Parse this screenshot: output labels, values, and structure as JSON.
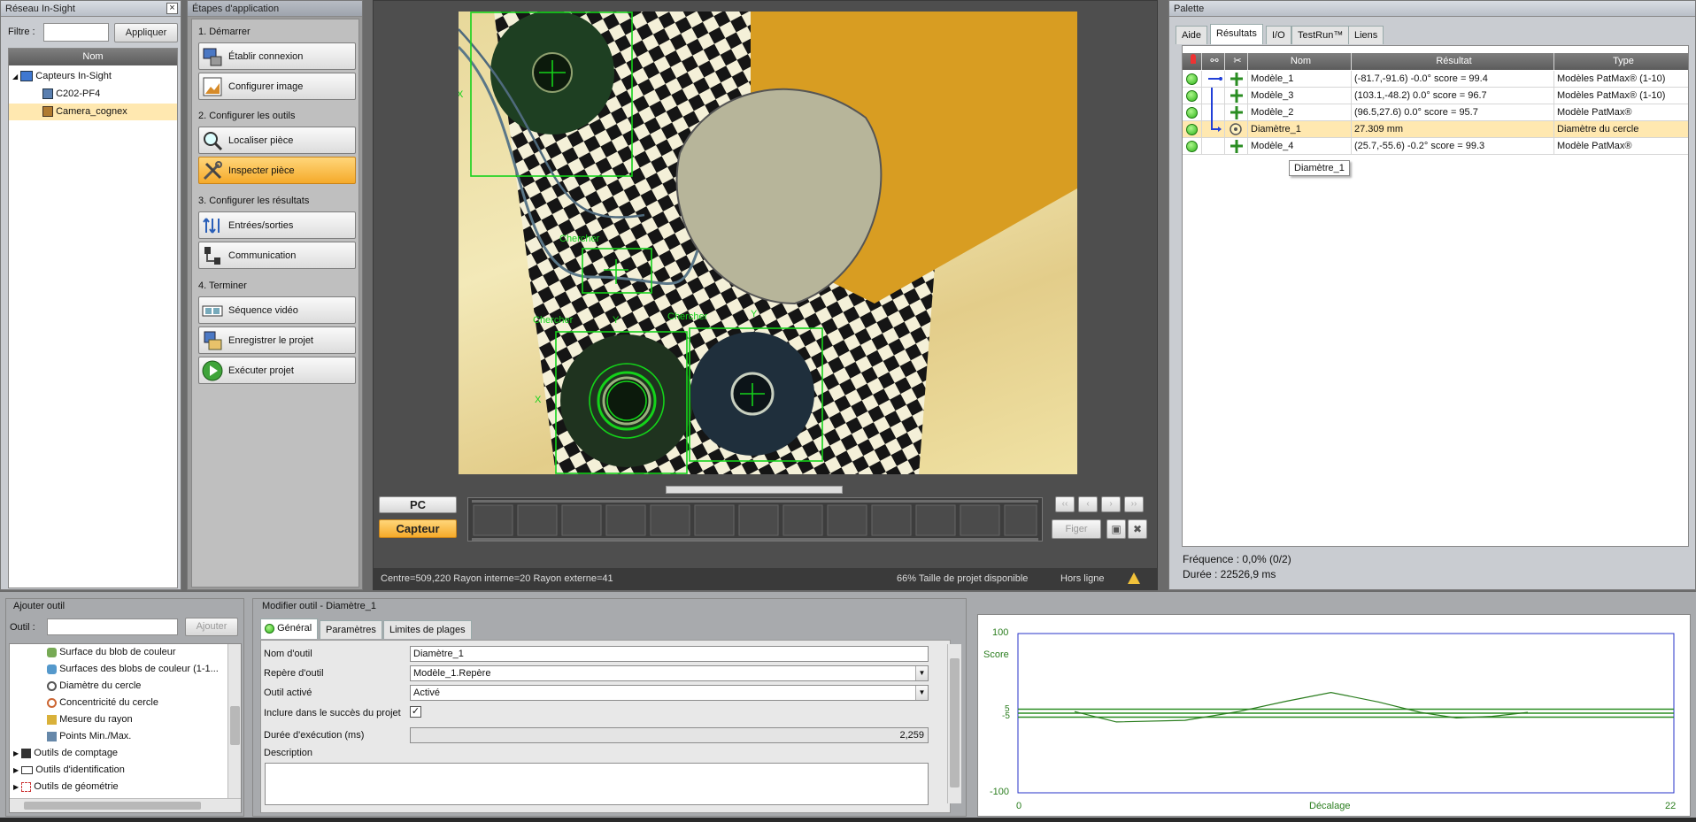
{
  "colors": {
    "accent": "#f6b231",
    "ok": "#2fb51a",
    "tool_green": "#14d21a",
    "selected_row": "#ffe8b0"
  },
  "network": {
    "title": "Réseau In-Sight",
    "filter_label": "Filtre :",
    "filter_value": "",
    "apply_label": "Appliquer",
    "column_name": "Nom",
    "root": "Capteurs In-Sight",
    "items": [
      "C202-PF4",
      "Camera_cognex"
    ]
  },
  "steps": {
    "title": "Étapes d'application",
    "sections": [
      {
        "label": "1. Démarrer",
        "buttons": [
          "Établir connexion",
          "Configurer image"
        ]
      },
      {
        "label": "2. Configurer les outils",
        "buttons": [
          "Localiser pièce",
          "Inspecter pièce"
        ]
      },
      {
        "label": "3. Configurer les résultats",
        "buttons": [
          "Entrées/sorties",
          "Communication"
        ]
      },
      {
        "label": "4. Terminer",
        "buttons": [
          "Séquence vidéo",
          "Enregistrer le projet",
          "Exécuter projet"
        ]
      }
    ]
  },
  "viewer": {
    "overlay_labels": {
      "find_1": "Chercher",
      "find_2": "Chercher",
      "find_3": "Chercher",
      "x": "X",
      "y": "Y"
    },
    "pc_label": "PC",
    "sensor_label": "Capteur",
    "freeze_label": "Figer",
    "status_left": "Centre=509,220 Rayon interne=20 Rayon externe=41",
    "status_mid": "66% Taille de projet disponible",
    "status_right": "Hors ligne"
  },
  "palette": {
    "title": "Palette",
    "tabs": [
      "Aide",
      "Résultats",
      "I/O",
      "TestRun™",
      "Liens"
    ],
    "active_tab": "Résultats",
    "columns": {
      "name": "Nom",
      "result": "Résultat",
      "type": "Type"
    },
    "rows": [
      {
        "name": "Modèle_1",
        "result": "(-81.7,-91.6) -0.0° score = 99.4",
        "type": "Modèles PatMax® (1-10)"
      },
      {
        "name": "Modèle_3",
        "result": "(103.1,-48.2) 0.0° score = 96.7",
        "type": "Modèles PatMax® (1-10)"
      },
      {
        "name": "Modèle_2",
        "result": "(96.5,27.6) 0.0° score = 95.7",
        "type": "Modèle PatMax®"
      },
      {
        "name": "Diamètre_1",
        "result": "27.309 mm",
        "type": "Diamètre du cercle"
      },
      {
        "name": "Modèle_4",
        "result": "(25.7,-55.6) -0.2° score = 99.3",
        "type": "Modèle PatMax®"
      }
    ],
    "tooltip": "Diamètre_1",
    "frequency": "Fréquence : 0,0% (0/2)",
    "duration": "Durée : 22526,9 ms"
  },
  "add_tool": {
    "title": "Ajouter outil",
    "tool_label": "Outil :",
    "tool_value": "",
    "add_label": "Ajouter",
    "tree": [
      "Surface du blob de couleur",
      "Surfaces des blobs de couleur (1-1...",
      "Diamètre du cercle",
      "Concentricité du cercle",
      "Mesure du rayon",
      "Points Min./Max."
    ],
    "groups": [
      "Outils de comptage",
      "Outils d'identification",
      "Outils de géométrie"
    ]
  },
  "edit_tool": {
    "title": "Modifier outil - Diamètre_1",
    "tabs": [
      "Général",
      "Paramètres",
      "Limites de plages"
    ],
    "fields": {
      "name_label": "Nom d'outil",
      "name_value": "Diamètre_1",
      "frame_label": "Repère d'outil",
      "frame_value": "Modèle_1.Repère",
      "enabled_label": "Outil activé",
      "enabled_value": "Activé",
      "include_label": "Inclure dans le succès du projet",
      "exec_label": "Durée d'exécution (ms)",
      "exec_value": "2,259",
      "desc_label": "Description",
      "desc_value": ""
    }
  },
  "chart_data": {
    "type": "line",
    "ylabel": "Score",
    "xlabel": "Décalage",
    "xlim": [
      0,
      22
    ],
    "ylim": [
      -100,
      100
    ],
    "yticks": [
      "100",
      "5",
      "-5",
      "-100"
    ],
    "xticks": [
      "0",
      "22"
    ],
    "thresholds": [
      5,
      -5,
      0
    ],
    "x": [
      1.9,
      3.3,
      5.6,
      7.4,
      9.0,
      10.5,
      12.1,
      13.5,
      14.7,
      15.9,
      17.1
    ],
    "y": [
      2,
      -11,
      -9,
      2,
      15,
      26,
      14,
      1,
      -6,
      -4,
      1
    ]
  }
}
